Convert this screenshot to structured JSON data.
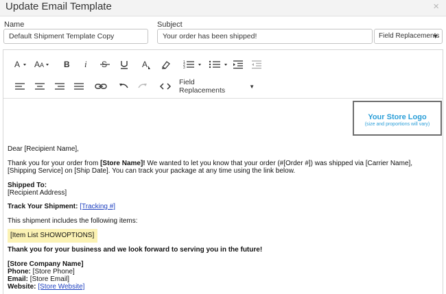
{
  "window": {
    "title": "Update Email Template",
    "close_glyph": "×"
  },
  "form": {
    "name_label": "Name",
    "name_value": "Default Shipment Template Copy",
    "subject_label": "Subject",
    "subject_value": "Your order has been shipped!",
    "field_replacements_label": "Field Replacements"
  },
  "toolbar": {
    "field_replacements_label": "Field Replacements",
    "icons": [
      "font-size-icon",
      "font-family-icon",
      "bold-icon",
      "italic-icon",
      "strikethrough-icon",
      "underline-icon",
      "font-color-icon",
      "highlight-icon",
      "ordered-list-icon",
      "unordered-list-icon",
      "indent-icon",
      "outdent-icon",
      "align-left-icon",
      "align-center-icon",
      "align-right-icon",
      "justify-icon",
      "link-icon",
      "undo-icon",
      "redo-icon",
      "code-view-icon"
    ]
  },
  "content": {
    "logo_title": "Your Store Logo",
    "logo_sub": "(size and proportions will vary)",
    "greeting": "Dear [Recipient Name],",
    "thanks_1": "Thank you for your order from ",
    "store_name": "[Store Name]!",
    "thanks_2": " We wanted to let you know that your order (#[Order #]) was shipped via [Carrier Name], [Shipping Service] on [Ship Date].  You can track your package at any time using the link below.",
    "shipped_to_label": "Shipped To:",
    "recipient_address": "[Recipient Address]",
    "track_label": "Track Your Shipment:",
    "tracking_link": "[Tracking #]",
    "items_intro": "This shipment includes the following items:",
    "item_list": "[Item List SHOWOPTIONS]",
    "closing": "Thank you for your business and we look forward to serving you in the future!",
    "company_name": "[Store Company Name]",
    "phone_label": "Phone:",
    "phone_value": " [Store Phone]",
    "email_label": "Email:",
    "email_value": " [Store Email]",
    "website_label": "Website:",
    "website_link": "[Store Website]"
  },
  "colors": {
    "accent": "#2a9ed8",
    "highlight": "#fbf2b4",
    "link": "#1a3dbf"
  }
}
